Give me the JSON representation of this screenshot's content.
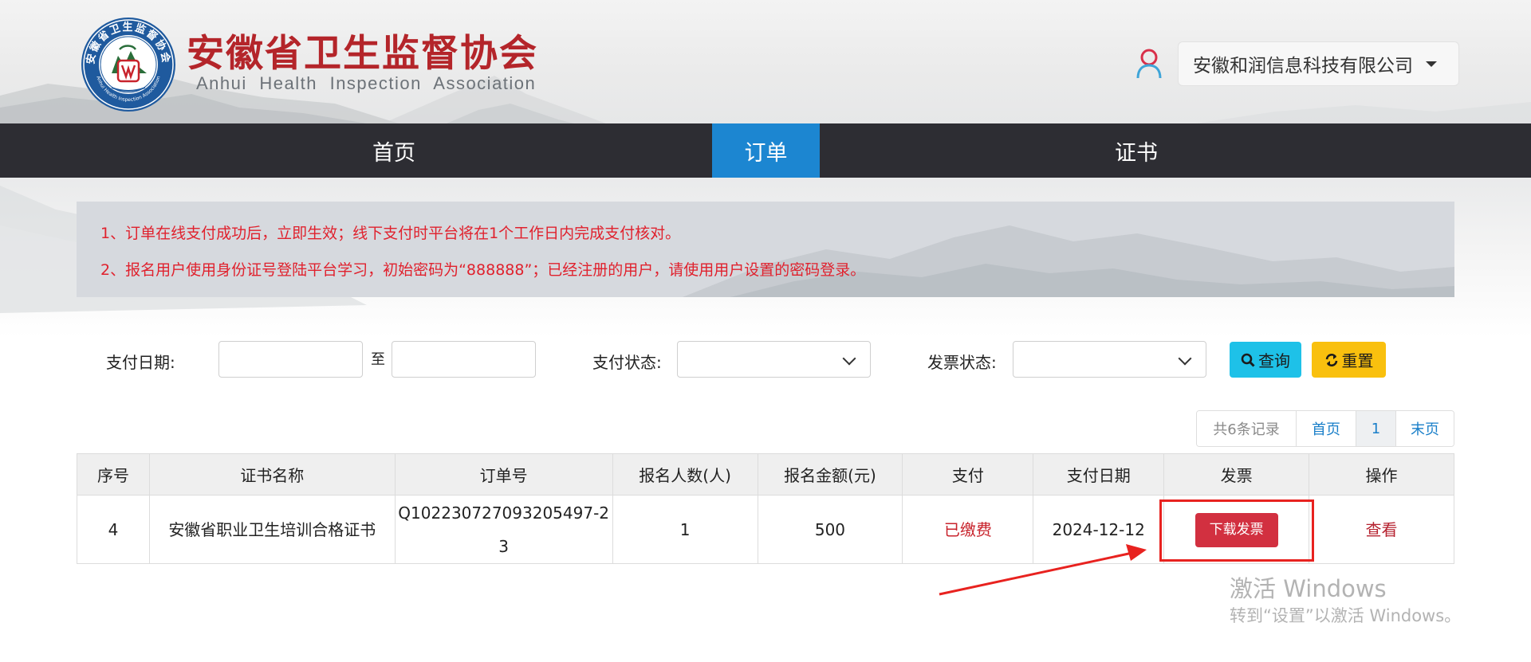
{
  "header": {
    "org_name": "安徽省卫生监督协会",
    "org_name_en": "Anhui Health Inspection Association",
    "logo_text": "安徽省卫生监督协会",
    "logo_text_en": "Anhui Health Inspection Association",
    "company": "安徽和润信息科技有限公司"
  },
  "nav": {
    "items": [
      {
        "label": "首页",
        "active": false
      },
      {
        "label": "订单",
        "active": true
      },
      {
        "label": "证书",
        "active": false
      }
    ]
  },
  "notice": {
    "line1": "1、订单在线支付成功后，立即生效；线下支付时平台将在1个工作日内完成支付核对。",
    "line2": "2、报名用户使用身份证号登陆平台学习，初始密码为“888888”；已经注册的用户，请使用用户设置的密码登录。"
  },
  "filters": {
    "pay_date_label": "支付日期:",
    "to_label": "至",
    "date_from": "",
    "date_to": "",
    "pay_status_label": "支付状态:",
    "pay_status_value": "",
    "invoice_status_label": "发票状态:",
    "invoice_status_value": "",
    "query_label": "查询",
    "reset_label": "重置"
  },
  "pagination": {
    "total": "共6条记录",
    "first": "首页",
    "current": "1",
    "last": "末页"
  },
  "table": {
    "headers": [
      "序号",
      "证书名称",
      "订单号",
      "报名人数(人)",
      "报名金额(元)",
      "支付",
      "支付日期",
      "发票",
      "操作"
    ],
    "rows": [
      {
        "no": "4",
        "cert_name": "安徽省职业卫生培训合格证书",
        "order_no_line1": "Q102230727093205497-2",
        "order_no_line2": "3",
        "count": "1",
        "amount": "500",
        "pay_status": "已缴费",
        "pay_date": "2024-12-12",
        "invoice_btn": "下载发票",
        "action": "查看"
      }
    ]
  },
  "watermark": {
    "line1": "激活 Windows",
    "line2": "转到“设置”以激活 Windows。"
  },
  "colors": {
    "brand_red": "#b4252a",
    "nav_bg": "#2d2d33",
    "nav_active": "#1c86d1",
    "notice_text": "#e0212d",
    "query_btn": "#1ec1e8",
    "reset_btn": "#f9c00e",
    "invoice_btn": "#d23040",
    "highlight": "#e8221f"
  }
}
